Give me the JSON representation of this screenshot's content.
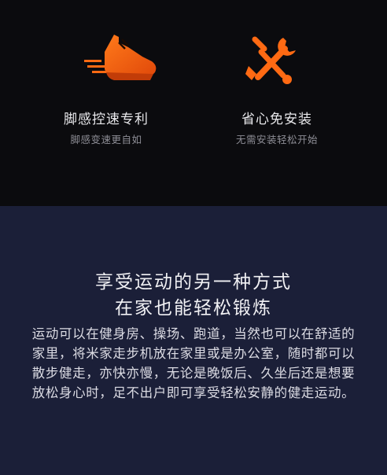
{
  "features": [
    {
      "title": "脚感控速专利",
      "subtitle": "脚感变速更自如",
      "icon": "running-shoe-icon"
    },
    {
      "title": "省心免安装",
      "subtitle": "无需安装轻松开始",
      "icon": "wrench-screwdriver-icon"
    }
  ],
  "colors": {
    "accent": "#ff6a13",
    "top_bg": "#0b0b0e",
    "bottom_bg": "#1b1f38"
  },
  "headline": {
    "line1": "享受运动的另一种方式",
    "line2": "在家也能轻松锻炼"
  },
  "description": "运动可以在健身房、操场、跑道，当然也可以在舒适的家里，将米家走步机放在家里或是办公室，随时都可以散步健走，亦快亦慢，无论是晚饭后、久坐后还是想要放松身心时，足不出户即可享受轻松安静的健走运动。"
}
